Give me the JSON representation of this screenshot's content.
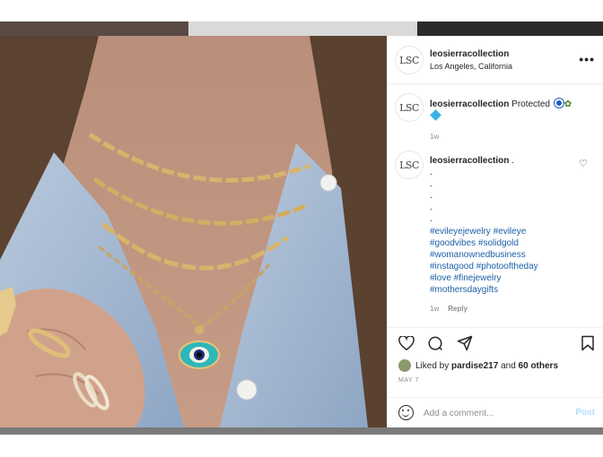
{
  "post": {
    "username": "leosierracollection",
    "location": "Los Angeles, California",
    "logo_text": "LSC",
    "more_label": "•••"
  },
  "comment1": {
    "username": "leosierracollection",
    "text": "Protected",
    "time": "1w"
  },
  "comment2": {
    "username": "leosierracollection",
    "trail": ".",
    "dots": [
      ".",
      ".",
      ".",
      ".",
      ".",
      "."
    ],
    "hashtags": [
      "#evileyejewelry #evileye",
      "#goodvibes #solidgold",
      "#womanownedbusiness",
      "#instagood #photooftheday",
      "#love #finejewelry",
      "#mothersdaygifts"
    ],
    "time": "1w",
    "reply_label": "Reply"
  },
  "engagement": {
    "liked_prefix": "Liked by",
    "liked_user": "pardise217",
    "liked_and": "and",
    "liked_others": "60 others",
    "date": "MAY 7"
  },
  "comment_box": {
    "placeholder": "Add a comment...",
    "post_label": "Post"
  },
  "icons": [
    "heart-icon",
    "comment-icon",
    "share-icon",
    "bookmark-icon",
    "emoji-icon",
    "evil-eye-emoji-icon",
    "plant-emoji-icon",
    "diamond-emoji-icon"
  ],
  "colors": {
    "link": "#1b5fa8",
    "muted": "#8e8e8e",
    "post_disabled": "#b2dffc"
  }
}
